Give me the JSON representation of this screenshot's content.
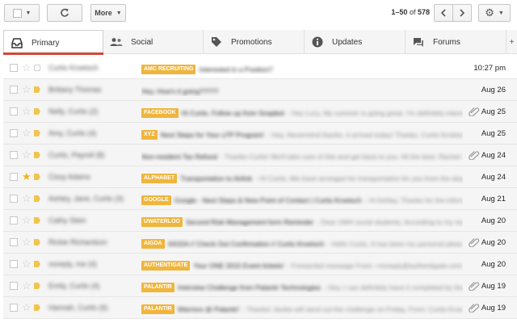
{
  "toolbar": {
    "more_label": "More",
    "pager_range": "1–50",
    "pager_of": "of",
    "pager_total": "578"
  },
  "tabs": [
    {
      "label": "Primary",
      "icon": "inbox-icon",
      "active": true
    },
    {
      "label": "Social",
      "icon": "people-icon"
    },
    {
      "label": "Promotions",
      "icon": "tag-icon"
    },
    {
      "label": "Updates",
      "icon": "info-icon"
    },
    {
      "label": "Forums",
      "icon": "forum-icon"
    }
  ],
  "add_tab_label": "+",
  "messages": [
    {
      "sender": "Curtis Kroetsch",
      "label": "AMC RECRUITING",
      "subject": "Interested in a Position?",
      "snippet": "",
      "date": "10:27 pm",
      "starred": false,
      "important": false,
      "attachment": false,
      "unread": true
    },
    {
      "sender": "Brittany Thomas",
      "label": "",
      "subject": "Hey, How's it going?????",
      "snippet": "",
      "date": "Aug 26",
      "starred": false,
      "important": true,
      "attachment": false,
      "unread": false
    },
    {
      "sender": "Nelly, Curtis (2)",
      "label": "FACEBOOK",
      "subject": "Hi Curtis, Follow up from Snapbot",
      "snippet": "- Hey Lucy, My summer is going great. I'm definitely interested in Snapbot",
      "date": "Aug 25",
      "starred": false,
      "important": true,
      "attachment": true,
      "unread": false
    },
    {
      "sender": "Amy, Curtis (4)",
      "label": "XYZ",
      "subject": "Next Steps for Your uTP Program!",
      "snippet": "- Hey, Nevermind thanks, it arrived today! Thanks, Curtis Kroetsch On Tue, Aug",
      "date": "Aug 25",
      "starred": false,
      "important": true,
      "attachment": false,
      "unread": false
    },
    {
      "sender": "Curtis, Payroll (8)",
      "label": "",
      "subject": "Non-resident Tax Refund",
      "snippet": "- Thanks Curtis! We'll take care of this and get back to you. All the best, Rachel Falls Payroll",
      "date": "Aug 24",
      "starred": false,
      "important": true,
      "attachment": true,
      "unread": false
    },
    {
      "sender": "Cissy Adams",
      "label": "ALPHABET",
      "subject": "Transportation to Airlink",
      "snippet": "- Hi Curtis, We have arranged for transportation for you from the airport to the hotel",
      "date": "Aug 24",
      "starred": true,
      "important": true,
      "attachment": false,
      "unread": false
    },
    {
      "sender": "Ashley, Jane, Curtis (3)",
      "label": "GOOGLE",
      "subject": "Google - Next Steps & New Point of Contact | Curtis Kroetsch",
      "snippet": "- Hi Ashley, Thanks for the information. Best",
      "date": "Aug 21",
      "starred": false,
      "important": true,
      "attachment": false,
      "unread": false
    },
    {
      "sender": "Cathy Stein",
      "label": "UWATERLOO",
      "subject": "Second Risk Management form Reminder",
      "snippet": "- Dear UW4 social students, According to my records, I am still",
      "date": "Aug 20",
      "starred": false,
      "important": true,
      "attachment": false,
      "unread": false
    },
    {
      "sender": "Rickie Richardson",
      "label": "AIGDA",
      "subject": "AIGDA // Check Out Confirmation // Curtis Kroetsch",
      "snippet": "- Hello Curtis, It has been my personal pleasure serving you",
      "date": "Aug 20",
      "starred": false,
      "important": true,
      "attachment": true,
      "unread": false
    },
    {
      "sender": "noreply, me (4)",
      "label": "AUTHENTIGATE",
      "subject": "Your ONE 2015 Event tickets!",
      "snippet": "- Forwarded message From: <noreply@authentigate.com> Date: Thu, Aug",
      "date": "Aug 20",
      "starred": false,
      "important": true,
      "attachment": false,
      "unread": false
    },
    {
      "sender": "Emily, Curtis (4)",
      "label": "PALANTIR",
      "subject": "Interview Challenge from Palantir Technologies",
      "snippet": "- Hey, I can definitely have it completed by the 29th! Thanks",
      "date": "Aug 19",
      "starred": false,
      "important": true,
      "attachment": true,
      "unread": false
    },
    {
      "sender": "Hannah, Curtis (6)",
      "label": "PALANTIR",
      "subject": "Warriors @ Palantir!",
      "snippet": "- Thanks! Jackie will send out the challenge on Friday. From: Curtis Kroetsch [mailto:curtis",
      "date": "Aug 19",
      "starred": false,
      "important": true,
      "attachment": true,
      "unread": false
    }
  ]
}
